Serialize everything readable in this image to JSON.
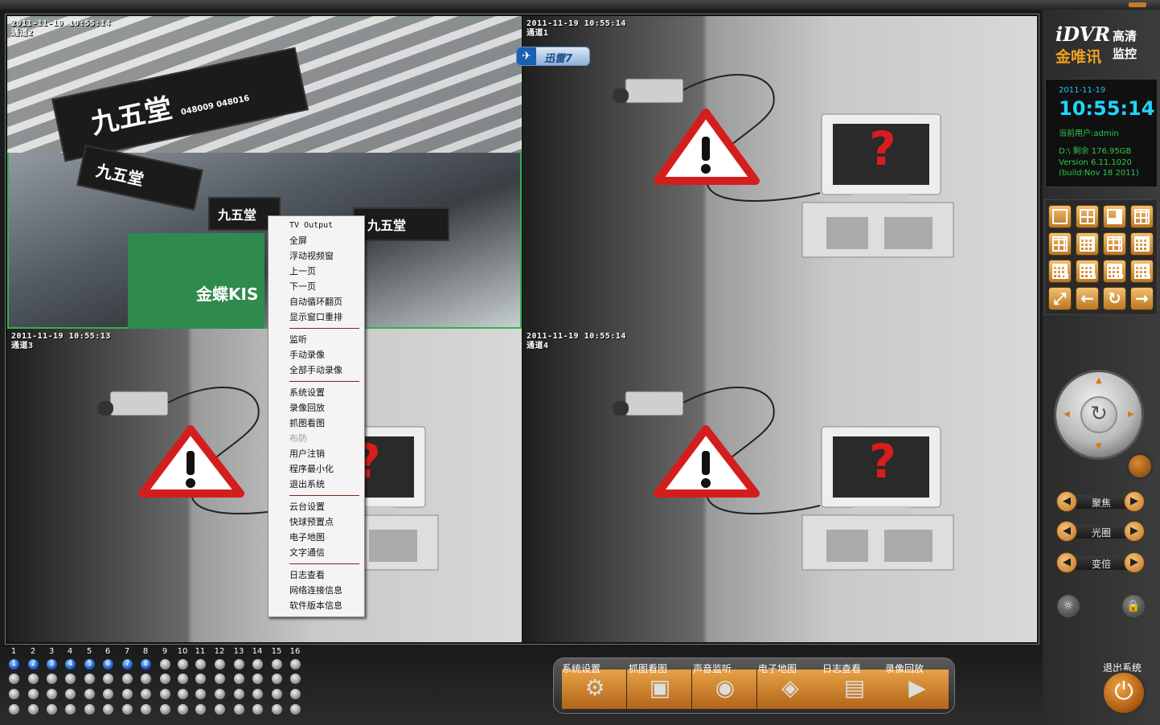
{
  "cells": [
    {
      "timestamp": "2011-11-19 10:55:14",
      "channel": "通道2"
    },
    {
      "timestamp": "2011-11-19 10:55:14",
      "channel": "通道1"
    },
    {
      "timestamp": "2011-11-19 10:55:13",
      "channel": "通道3"
    },
    {
      "timestamp": "2011-11-19 10:55:14",
      "channel": "通道4"
    }
  ],
  "overlay": {
    "xunlei_label": "迅雷7"
  },
  "camera_scene": {
    "sign_main": "九五堂",
    "sign_code": "048009 048016",
    "shop_text": "金蝶KIS"
  },
  "context_menu": {
    "groups": [
      [
        "TV Output",
        "全屏",
        "浮动视频窗",
        "上一页",
        "下一页",
        "自动循环翻页",
        "显示窗口重排"
      ],
      [
        "监听",
        "手动录像",
        "全部手动录像"
      ],
      [
        "系统设置",
        "录像回放",
        "抓图看图",
        "布防",
        "用户注销",
        "程序最小化",
        "退出系统"
      ],
      [
        "云台设置",
        "快球预置点",
        "电子地图",
        "文字通信"
      ],
      [
        "日志查看",
        "网络连接信息",
        "软件版本信息"
      ]
    ],
    "disabled_item": "布防"
  },
  "logo": {
    "brand_en": "iDVR",
    "brand_suffix": "高清",
    "brand_cn": "金唯讯",
    "brand_cn_suffix": "监控"
  },
  "info": {
    "date": "2011-11-19",
    "time": "10:55:14",
    "user": "当前用户:admin",
    "disk": "D:\\  剩余  176.95GB",
    "version": "Version 6.11.1020",
    "build": "(build:Nov 18 2011)"
  },
  "layout_buttons": {
    "numbered": [
      "28",
      "36",
      "49",
      "64"
    ]
  },
  "ptz_controls": {
    "focus": "聚焦",
    "iris": "光圈",
    "zoom": "变倍"
  },
  "channels": {
    "numbers": [
      "1",
      "2",
      "3",
      "4",
      "5",
      "6",
      "7",
      "8",
      "9",
      "10",
      "11",
      "12",
      "13",
      "14",
      "15",
      "16"
    ],
    "active_labels": [
      "1",
      "2",
      "3",
      "4",
      "5",
      "6",
      "7",
      "8"
    ]
  },
  "toolbar": {
    "items": [
      "系统设置",
      "抓图看图",
      "声音监听",
      "电子地图",
      "日志查看",
      "录像回放"
    ],
    "exit": "退出系统"
  },
  "colors": {
    "accent": "#d9822b",
    "selected_border": "#2fb34a",
    "info_text": "#2ec84a",
    "time_text": "#22d3ff"
  }
}
